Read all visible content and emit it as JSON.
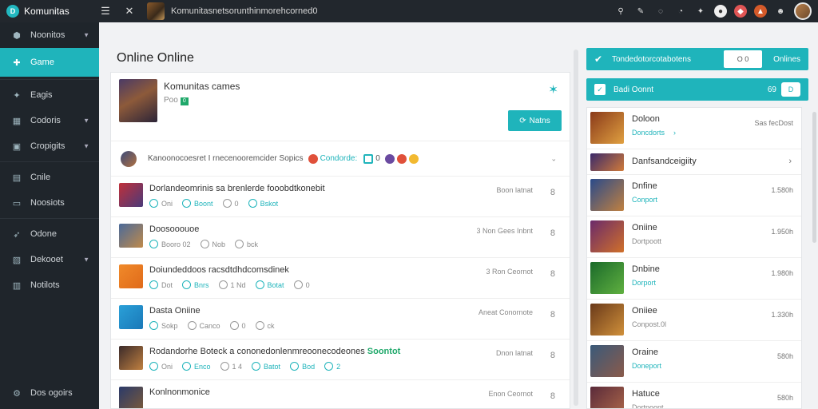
{
  "topbar": {
    "brand": "Komunitas",
    "brand_logo": "D",
    "title": "Komunitasnetsorunthinmorehcorned0"
  },
  "sidebar": {
    "items": [
      {
        "label": "Noonitos",
        "icon": "hexagon-icon",
        "chevron": true
      },
      {
        "label": "Game",
        "icon": "gamepad-icon",
        "active": true
      },
      {
        "label": "Eagis",
        "icon": "puzzle-icon"
      },
      {
        "label": "Codoris",
        "icon": "grid-icon",
        "chevron": true
      },
      {
        "label": "Cropigits",
        "icon": "box-icon",
        "chevron": true
      },
      {
        "label": "Cnile",
        "icon": "table-icon"
      },
      {
        "label": "Noosiots",
        "icon": "chat-icon"
      },
      {
        "label": "Odone",
        "icon": "rocket-icon"
      },
      {
        "label": "Dekooet",
        "icon": "image-icon",
        "chevron": true
      },
      {
        "label": "Notilots",
        "icon": "folder-icon"
      }
    ],
    "bottom": {
      "label": "Dos ogoirs",
      "icon": "settings-icon"
    }
  },
  "main": {
    "title": "Online Online",
    "hero": {
      "name": "Komunitas cames",
      "sub": "Poo",
      "badge": "0",
      "button": "Natns"
    },
    "filter": {
      "text": "Kanoonocoesret I rnecenooremcider Sopics",
      "link": "Condorde:",
      "count": "0"
    },
    "posts": [
      {
        "title": "Dorlandeomrinis sa  brenlerde fooobdtkonebit",
        "highlight": "",
        "meta": [
          [
            "",
            "Oni"
          ],
          [
            "tq",
            "Boont"
          ],
          [
            "g",
            "0"
          ],
          [
            "tq",
            "Bskot"
          ]
        ],
        "date": "Boon latnat",
        "more": "8",
        "img": "linear-gradient(135deg,#c0303a,#4a3a7a)"
      },
      {
        "title": "Doosooouoe",
        "highlight": "",
        "meta": [
          [
            "",
            "Booro 02"
          ],
          [
            "g",
            "Nob"
          ],
          [
            "g",
            "bck"
          ]
        ],
        "date": "3 Non Gees Inbnt",
        "more": "8",
        "img": "linear-gradient(135deg,#4a6a9a,#c08a4a)"
      },
      {
        "title": "Doiundeddoos  racsdtdhdcomsdinek",
        "highlight": "",
        "meta": [
          [
            "",
            "Dot"
          ],
          [
            "tq",
            "Bnrs"
          ],
          [
            "g",
            "1 Nd"
          ],
          [
            "tq",
            "Botat"
          ],
          [
            "g",
            "0"
          ]
        ],
        "date": "3 Ron Ceornot",
        "more": "8",
        "img": "linear-gradient(135deg,#f08a2a,#e06a1a)"
      },
      {
        "title": "Dasta Oniine",
        "highlight": "",
        "meta": [
          [
            "",
            "Sokp"
          ],
          [
            "g",
            "Canco"
          ],
          [
            "g",
            "0"
          ],
          [
            "g",
            "ck"
          ]
        ],
        "date": "Aneat Conornote",
        "more": "8",
        "img": "linear-gradient(135deg,#2aa0d8,#1a78b8)"
      },
      {
        "title": "Rodandorhe Boteck  a  cononedonlenmreoonecodeones",
        "highlight": "Soontot",
        "meta": [
          [
            "",
            "Oni"
          ],
          [
            "tq",
            "Enco"
          ],
          [
            "g",
            "1 4"
          ],
          [
            "tq",
            "Batot"
          ],
          [
            "tq",
            "Bod"
          ],
          [
            "tq",
            "2"
          ]
        ],
        "date": "Dnon latnat",
        "more": "8",
        "img": "linear-gradient(135deg,#3a2a2a,#c08040)"
      },
      {
        "title": "Konlnonmonice",
        "highlight": "",
        "meta": [],
        "date": "Enon Ceornot",
        "more": "8",
        "img": "linear-gradient(135deg,#2a3a6a,#7a5a3a)"
      }
    ]
  },
  "rpanel": {
    "head1": {
      "text": "Tondedotorcotabotens",
      "toggle": "O 0",
      "right": "Onlines"
    },
    "head2": {
      "text": "Badi Oonnt",
      "count": "69",
      "btn": "D"
    },
    "items": [
      {
        "name": "Doloon",
        "sub": "Doncdorts",
        "chev": "›",
        "val": "Sas fecDost",
        "img": "linear-gradient(135deg,#8a3a1a,#e0a040)"
      },
      {
        "name": "Danfsandceigiity",
        "small": true,
        "chev": "›",
        "img": "linear-gradient(135deg,#3a2a6a,#d07a3a)"
      },
      {
        "name": "Dnfine",
        "sub": "Conport",
        "val": "1.580h",
        "img": "linear-gradient(135deg,#2a4a8a,#c08040)"
      },
      {
        "name": "Oniine",
        "sub": "Dortpoott",
        "gray": true,
        "val": "1.950h",
        "img": "linear-gradient(135deg,#6a2a6a,#d0702a)"
      },
      {
        "name": "Dnbine",
        "sub": "Dorport",
        "val": "1.980h",
        "img": "linear-gradient(135deg,#1a6a2a,#60b040)"
      },
      {
        "name": "Oniiee",
        "sub": "Conpost.0l",
        "gray": true,
        "val": "1.330h",
        "img": "linear-gradient(135deg,#6a3a1a,#d0903a)"
      },
      {
        "name": "Oraine",
        "sub": "Doneport",
        "val": "580h",
        "img": "linear-gradient(135deg,#3a5a7a,#8a5a4a)"
      },
      {
        "name": "Hatuce",
        "sub": "Dortpoont",
        "gray": true,
        "val": "580h",
        "img": "linear-gradient(135deg,#5a2a3a,#b06a4a)"
      }
    ]
  },
  "colors": {
    "accent": "#1fb4bb",
    "topbar": "#22272d",
    "sidebar": "#1f252b"
  }
}
